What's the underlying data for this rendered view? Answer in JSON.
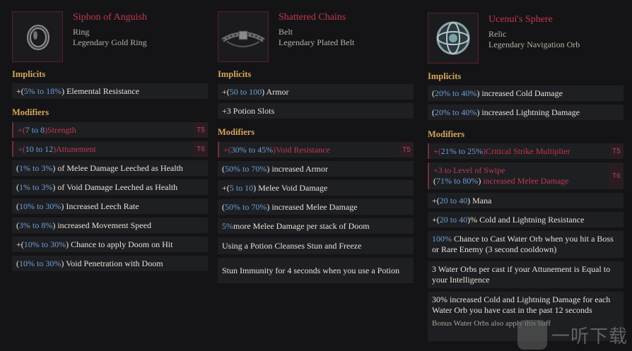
{
  "cards": [
    {
      "name": "Siphon of Anguish",
      "type": "Ring",
      "base": "Legendary Gold Ring",
      "icon": "ring-icon",
      "implicits_label": "Implicits",
      "implicits": [
        {
          "pre": "+(",
          "range": "5% to 18%",
          "post": ") Elemental Resistance"
        }
      ],
      "modifiers_label": "Modifiers",
      "modifiers": [
        {
          "pre": "+(",
          "range": "7 to 8",
          "post": ") ",
          "name": "Strength",
          "tier": "T5"
        },
        {
          "pre": "+(",
          "range": "10 to 12",
          "post": ") ",
          "name": "Attunement",
          "tier": "T6"
        },
        {
          "pre": "(",
          "range": "1% to 3%",
          "post": ") of Melee Damage Leeched as Health"
        },
        {
          "pre": "(",
          "range": "1% to 3%",
          "post": ") of Void Damage Leeched as Health"
        },
        {
          "pre": "(",
          "range": "10% to 30%",
          "post": ") Increased Leech Rate"
        },
        {
          "pre": "(",
          "range": "3% to 8%",
          "post": ") increased Movement Speed"
        },
        {
          "pre": "+(",
          "range": "10% to 30%",
          "post": ") Chance to apply Doom on Hit"
        },
        {
          "pre": "(",
          "range": "10% to 30%",
          "post": ") Void Penetration with Doom"
        }
      ]
    },
    {
      "name": "Shattered Chains",
      "type": "Belt",
      "base": "Legendary Plated Belt",
      "icon": "belt-icon",
      "implicits_label": "Implicits",
      "implicits": [
        {
          "pre": "+(",
          "range": "50 to 100",
          "post": ") Armor"
        },
        {
          "pre": "+3 Potion Slots"
        }
      ],
      "modifiers_label": "Modifiers",
      "modifiers": [
        {
          "pre": "+(",
          "range": "30% to 45%",
          "post": ") ",
          "name": "Void Resistance",
          "tier": "T5"
        },
        {
          "pre": "(",
          "range": "50% to 70%",
          "post": ") increased Armor"
        },
        {
          "pre": "+(",
          "range": "5 to 10",
          "post": ") Melee Void Damage"
        },
        {
          "pre": "(",
          "range": "50% to 70%",
          "post": ") increased Melee Damage"
        },
        {
          "range": "5%",
          "post": " more Melee Damage per stack of Doom"
        },
        {
          "pre": "Using a Potion Cleanses Stun and Freeze"
        },
        {
          "pre": "Stun Immunity for 4 seconds when you use a Potion"
        }
      ]
    },
    {
      "name": "Ucenui's Sphere",
      "type": "Relic",
      "base": "Legendary Navigation Orb",
      "icon": "orb-icon",
      "implicits_label": "Implicits",
      "implicits": [
        {
          "pre": "(",
          "range": "20% to 40%",
          "post": ") increased Cold Damage"
        },
        {
          "pre": "(",
          "range": "20% to 40%",
          "post": ") increased Lightning Damage"
        }
      ],
      "modifiers_label": "Modifiers",
      "modifiers": [
        {
          "pre": "+(",
          "range": "21% to 25%",
          "post": ") ",
          "name": "Critical Strike Multiplier",
          "tier": "T5"
        },
        {
          "line1": "+3 to Level of Swipe",
          "pre": "(",
          "range": "71% to 80%",
          "post": ") ",
          "name": "increased Melee Damage",
          "tier": "T6"
        },
        {
          "pre": "+(",
          "range": "20 to 40",
          "post": ") Mana"
        },
        {
          "pre": "+(",
          "range": "20 to 40",
          "post": ")% Cold and Lightning Resistance"
        },
        {
          "range": "100%",
          "post": " Chance to Cast Water Orb when you hit a Boss or Rare Enemy (3 second cooldown)"
        },
        {
          "pre": "3 Water Orbs per cast if your Attunement is Equal to your Intelligence"
        },
        {
          "pre": "30% increased Cold and Lightning Damage for each Water Orb you have cast in the past 12 seconds",
          "note": "Bonus Water Orbs also apply this buff"
        }
      ]
    }
  ],
  "watermark": {
    "text": "一听下载"
  },
  "colors": {
    "accent": "#c2384f",
    "range": "#6f9fd6",
    "section": "#d6a75a",
    "background": "#141416",
    "row": "#1e1f22"
  }
}
